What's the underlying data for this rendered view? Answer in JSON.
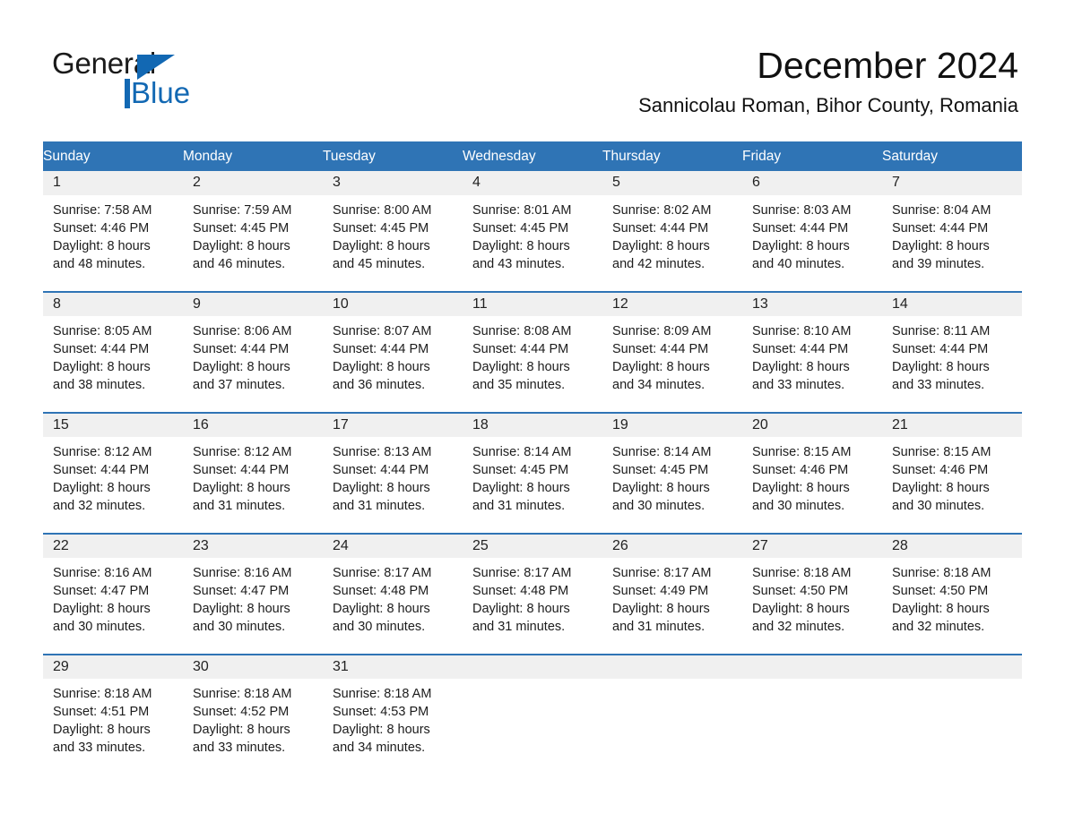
{
  "brand": {
    "name_part1": "General",
    "name_part2": "Blue",
    "accent_color": "#1268b3"
  },
  "header": {
    "month_title": "December 2024",
    "location": "Sannicolau Roman, Bihor County, Romania"
  },
  "calendar": {
    "header_bg": "#2f74b5",
    "daynum_bg": "#f0f0f0",
    "weekday_names": [
      "Sunday",
      "Monday",
      "Tuesday",
      "Wednesday",
      "Thursday",
      "Friday",
      "Saturday"
    ],
    "weeks": [
      [
        {
          "day": "1",
          "info": "Sunrise: 7:58 AM\nSunset: 4:46 PM\nDaylight: 8 hours\nand 48 minutes."
        },
        {
          "day": "2",
          "info": "Sunrise: 7:59 AM\nSunset: 4:45 PM\nDaylight: 8 hours\nand 46 minutes."
        },
        {
          "day": "3",
          "info": "Sunrise: 8:00 AM\nSunset: 4:45 PM\nDaylight: 8 hours\nand 45 minutes."
        },
        {
          "day": "4",
          "info": "Sunrise: 8:01 AM\nSunset: 4:45 PM\nDaylight: 8 hours\nand 43 minutes."
        },
        {
          "day": "5",
          "info": "Sunrise: 8:02 AM\nSunset: 4:44 PM\nDaylight: 8 hours\nand 42 minutes."
        },
        {
          "day": "6",
          "info": "Sunrise: 8:03 AM\nSunset: 4:44 PM\nDaylight: 8 hours\nand 40 minutes."
        },
        {
          "day": "7",
          "info": "Sunrise: 8:04 AM\nSunset: 4:44 PM\nDaylight: 8 hours\nand 39 minutes."
        }
      ],
      [
        {
          "day": "8",
          "info": "Sunrise: 8:05 AM\nSunset: 4:44 PM\nDaylight: 8 hours\nand 38 minutes."
        },
        {
          "day": "9",
          "info": "Sunrise: 8:06 AM\nSunset: 4:44 PM\nDaylight: 8 hours\nand 37 minutes."
        },
        {
          "day": "10",
          "info": "Sunrise: 8:07 AM\nSunset: 4:44 PM\nDaylight: 8 hours\nand 36 minutes."
        },
        {
          "day": "11",
          "info": "Sunrise: 8:08 AM\nSunset: 4:44 PM\nDaylight: 8 hours\nand 35 minutes."
        },
        {
          "day": "12",
          "info": "Sunrise: 8:09 AM\nSunset: 4:44 PM\nDaylight: 8 hours\nand 34 minutes."
        },
        {
          "day": "13",
          "info": "Sunrise: 8:10 AM\nSunset: 4:44 PM\nDaylight: 8 hours\nand 33 minutes."
        },
        {
          "day": "14",
          "info": "Sunrise: 8:11 AM\nSunset: 4:44 PM\nDaylight: 8 hours\nand 33 minutes."
        }
      ],
      [
        {
          "day": "15",
          "info": "Sunrise: 8:12 AM\nSunset: 4:44 PM\nDaylight: 8 hours\nand 32 minutes."
        },
        {
          "day": "16",
          "info": "Sunrise: 8:12 AM\nSunset: 4:44 PM\nDaylight: 8 hours\nand 31 minutes."
        },
        {
          "day": "17",
          "info": "Sunrise: 8:13 AM\nSunset: 4:44 PM\nDaylight: 8 hours\nand 31 minutes."
        },
        {
          "day": "18",
          "info": "Sunrise: 8:14 AM\nSunset: 4:45 PM\nDaylight: 8 hours\nand 31 minutes."
        },
        {
          "day": "19",
          "info": "Sunrise: 8:14 AM\nSunset: 4:45 PM\nDaylight: 8 hours\nand 30 minutes."
        },
        {
          "day": "20",
          "info": "Sunrise: 8:15 AM\nSunset: 4:46 PM\nDaylight: 8 hours\nand 30 minutes."
        },
        {
          "day": "21",
          "info": "Sunrise: 8:15 AM\nSunset: 4:46 PM\nDaylight: 8 hours\nand 30 minutes."
        }
      ],
      [
        {
          "day": "22",
          "info": "Sunrise: 8:16 AM\nSunset: 4:47 PM\nDaylight: 8 hours\nand 30 minutes."
        },
        {
          "day": "23",
          "info": "Sunrise: 8:16 AM\nSunset: 4:47 PM\nDaylight: 8 hours\nand 30 minutes."
        },
        {
          "day": "24",
          "info": "Sunrise: 8:17 AM\nSunset: 4:48 PM\nDaylight: 8 hours\nand 30 minutes."
        },
        {
          "day": "25",
          "info": "Sunrise: 8:17 AM\nSunset: 4:48 PM\nDaylight: 8 hours\nand 31 minutes."
        },
        {
          "day": "26",
          "info": "Sunrise: 8:17 AM\nSunset: 4:49 PM\nDaylight: 8 hours\nand 31 minutes."
        },
        {
          "day": "27",
          "info": "Sunrise: 8:18 AM\nSunset: 4:50 PM\nDaylight: 8 hours\nand 32 minutes."
        },
        {
          "day": "28",
          "info": "Sunrise: 8:18 AM\nSunset: 4:50 PM\nDaylight: 8 hours\nand 32 minutes."
        }
      ],
      [
        {
          "day": "29",
          "info": "Sunrise: 8:18 AM\nSunset: 4:51 PM\nDaylight: 8 hours\nand 33 minutes."
        },
        {
          "day": "30",
          "info": "Sunrise: 8:18 AM\nSunset: 4:52 PM\nDaylight: 8 hours\nand 33 minutes."
        },
        {
          "day": "31",
          "info": "Sunrise: 8:18 AM\nSunset: 4:53 PM\nDaylight: 8 hours\nand 34 minutes."
        },
        {
          "day": "",
          "info": ""
        },
        {
          "day": "",
          "info": ""
        },
        {
          "day": "",
          "info": ""
        },
        {
          "day": "",
          "info": ""
        }
      ]
    ]
  }
}
